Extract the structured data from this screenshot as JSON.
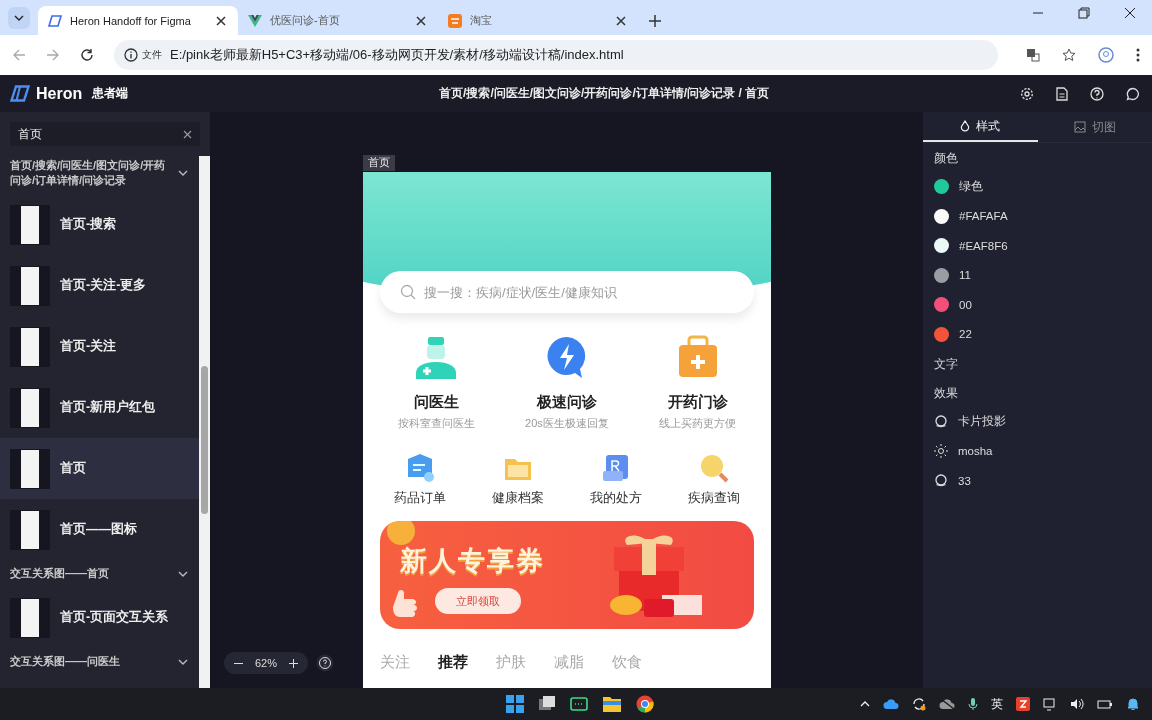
{
  "browser": {
    "tabs": [
      {
        "title": "Heron Handoff for Figma",
        "selected": true
      },
      {
        "title": "优医问诊-首页",
        "selected": false
      },
      {
        "title": "淘宝",
        "selected": false
      }
    ],
    "address": {
      "scheme_label": "文件",
      "url": "E:/pink老师最新H5+C3+移动端/06-移动网页开发/素材/移动端设计稿/index.html"
    }
  },
  "app": {
    "logo": "Heron",
    "subtitle": "患者端",
    "breadcrumb": "首页/搜索/问医生/图文问诊/开药问诊/订单详情/问诊记录 / 首页"
  },
  "sidebar": {
    "search": {
      "value": "首页"
    },
    "groups": [
      {
        "title": "首页/搜索/问医生/图文问诊/开药问诊/订单详情/问诊记录",
        "pages": [
          {
            "name": "首页-搜索",
            "selected": false
          },
          {
            "name": "首页-关注-更多",
            "selected": false
          },
          {
            "name": "首页-关注",
            "selected": false
          },
          {
            "name": "首页-新用户红包",
            "selected": false
          },
          {
            "name": "首页",
            "selected": true
          },
          {
            "name": "首页——图标",
            "selected": false
          }
        ]
      },
      {
        "title": "交互关系图——首页",
        "pages": [
          {
            "name": "首页-页面交互关系",
            "selected": false
          }
        ]
      },
      {
        "title": "交互关系图——问医生"
      }
    ]
  },
  "canvas": {
    "frame_label": "首页",
    "zoom": "62%"
  },
  "phone": {
    "search_placeholder": "搜一搜：疾病/症状/医生/健康知识",
    "main_services": [
      {
        "title": "问医生",
        "subtitle": "按科室查问医生"
      },
      {
        "title": "极速问诊",
        "subtitle": "20s医生极速回复"
      },
      {
        "title": "开药门诊",
        "subtitle": "线上买药更方便"
      }
    ],
    "shortcuts": [
      "药品订单",
      "健康档案",
      "我的处方",
      "疾病查询"
    ],
    "banner": {
      "title": "新人专享券",
      "button": "立即领取"
    },
    "feed_tabs": [
      {
        "label": "关注",
        "selected": false
      },
      {
        "label": "推荐",
        "selected": true
      },
      {
        "label": "护肤",
        "selected": false
      },
      {
        "label": "减脂",
        "selected": false
      },
      {
        "label": "饮食",
        "selected": false
      }
    ]
  },
  "inspector": {
    "tabs": [
      {
        "label": "样式",
        "selected": true
      },
      {
        "label": "切图",
        "selected": false
      }
    ],
    "colors_heading": "颜色",
    "colors": [
      {
        "name": "绿色",
        "color": "#21c99a"
      },
      {
        "name": "#FAFAFA",
        "color": "#fafafa"
      },
      {
        "name": "#EAF8F6",
        "color": "#eaf8f6"
      },
      {
        "name": "11",
        "color": "#9c9ca4"
      },
      {
        "name": "00",
        "color": "#f2507a"
      },
      {
        "name": "22",
        "color": "#f4533a"
      }
    ],
    "text_heading": "文字",
    "effects_heading": "效果",
    "effects": [
      {
        "name": "卡片投影",
        "kind": "shadow"
      },
      {
        "name": "mosha",
        "kind": "blur"
      },
      {
        "name": "33",
        "kind": "shadow"
      }
    ]
  },
  "taskbar": {
    "input_method": "英"
  }
}
